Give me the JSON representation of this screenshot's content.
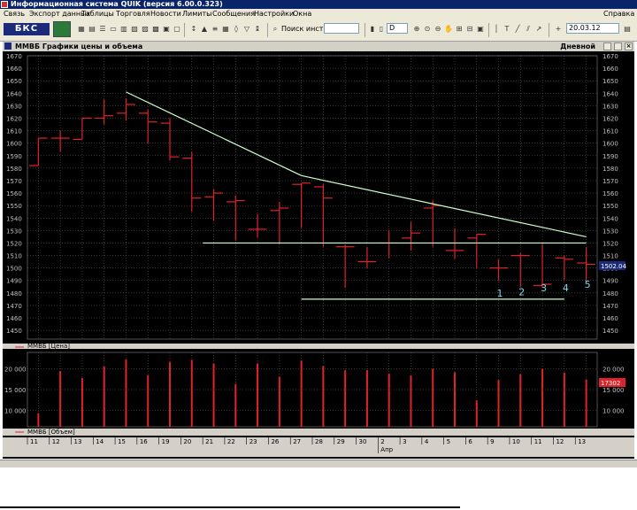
{
  "window": {
    "title": "Информационная система QUIK (версия 6.00.0.323)"
  },
  "menu": {
    "items": [
      "Связь",
      "Экспорт данных",
      "Таблицы",
      "Торговля",
      "Новости",
      "Лимиты",
      "Сообщения",
      "Настройки",
      "Окна"
    ],
    "help": "Справка"
  },
  "toolbar": {
    "logo": "БКС",
    "search_label": "Поиск инстр-та",
    "period_value": "D",
    "date_value": "20.03.12"
  },
  "panel": {
    "title": "ММВБ Графики цены и объема",
    "interval": "Дневной"
  },
  "legend": {
    "price": "ММВБ [Цена]",
    "volume": "ММВБ [Объем]"
  },
  "price_value_label": "1502.04",
  "volume_value_label": "17302",
  "chart_data": [
    {
      "type": "ohlc",
      "instrument": "ММВБ",
      "y_ticks": [
        1450,
        1460,
        1470,
        1480,
        1490,
        1500,
        1510,
        1520,
        1530,
        1540,
        1550,
        1560,
        1570,
        1580,
        1590,
        1600,
        1610,
        1620,
        1630,
        1640,
        1650,
        1660,
        1670
      ],
      "ylim": [
        1443,
        1670
      ],
      "x_labels": [
        "11",
        "12",
        "13",
        "14",
        "15",
        "16",
        "19",
        "20",
        "21",
        "22",
        "23",
        "26",
        "27",
        "28",
        "29",
        "30",
        "2",
        "3",
        "4",
        "5",
        "6",
        "9",
        "10",
        "11",
        "12",
        "13"
      ],
      "month_label": "Апр",
      "bars": [
        {
          "o": 1582,
          "h": 1601,
          "l": 1582,
          "c": 1604
        },
        {
          "o": 1604,
          "h": 1610,
          "l": 1593,
          "c": 1604
        },
        {
          "o": 1603,
          "h": 1617,
          "l": 1603,
          "c": 1620
        },
        {
          "o": 1620,
          "h": 1635,
          "l": 1615,
          "c": 1622
        },
        {
          "o": 1624,
          "h": 1636,
          "l": 1618,
          "c": 1631
        },
        {
          "o": 1624,
          "h": 1627,
          "l": 1600,
          "c": 1617
        },
        {
          "o": 1616,
          "h": 1620,
          "l": 1586,
          "c": 1589
        },
        {
          "o": 1588,
          "h": 1593,
          "l": 1545,
          "c": 1556
        },
        {
          "o": 1557,
          "h": 1563,
          "l": 1538,
          "c": 1560
        },
        {
          "o": 1553,
          "h": 1558,
          "l": 1522,
          "c": 1554
        },
        {
          "o": 1531,
          "h": 1543,
          "l": 1524,
          "c": 1531
        },
        {
          "o": 1546,
          "h": 1553,
          "l": 1519,
          "c": 1548
        },
        {
          "o": 1567,
          "h": 1566,
          "l": 1532,
          "c": 1568
        },
        {
          "o": 1565,
          "h": 1567,
          "l": 1517,
          "c": 1556
        },
        {
          "o": 1517,
          "h": 1519,
          "l": 1484,
          "c": 1517
        },
        {
          "o": 1505,
          "h": 1517,
          "l": 1500,
          "c": 1505
        },
        {
          "o": 1520,
          "h": 1530,
          "l": 1508,
          "c": 1520
        },
        {
          "o": 1524,
          "h": 1537,
          "l": 1514,
          "c": 1528
        },
        {
          "o": 1548,
          "h": 1554,
          "l": 1517,
          "c": 1550
        },
        {
          "o": 1514,
          "h": 1532,
          "l": 1507,
          "c": 1514
        },
        {
          "o": 1524,
          "h": 1527,
          "l": 1500,
          "c": 1527
        },
        {
          "o": 1500,
          "h": 1507,
          "l": 1490,
          "c": 1500
        },
        {
          "o": 1510,
          "h": 1512,
          "l": 1485,
          "c": 1510
        },
        {
          "o": 1486,
          "h": 1520,
          "l": 1484,
          "c": 1487
        },
        {
          "o": 1508,
          "h": 1510,
          "l": 1490,
          "c": 1507
        },
        {
          "o": 1504,
          "h": 1517,
          "l": 1490,
          "c": 1503
        }
      ],
      "lines": [
        {
          "from": [
            4,
            1641
          ],
          "to": [
            12,
            1574
          ]
        },
        {
          "from": [
            12,
            1574
          ],
          "to": [
            25,
            1525
          ]
        },
        {
          "from": [
            7.5,
            1520
          ],
          "to": [
            25,
            1520
          ]
        },
        {
          "from": [
            12,
            1475
          ],
          "to": [
            24,
            1475
          ]
        }
      ],
      "wave_labels": [
        "1",
        "2",
        "3",
        "4",
        "5"
      ],
      "wave_points": [
        {
          "x": 21,
          "y": 1480
        },
        {
          "x": 22,
          "y": 1481
        },
        {
          "x": 23,
          "y": 1484
        },
        {
          "x": 24,
          "y": 1484
        },
        {
          "x": 25,
          "y": 1487
        }
      ],
      "colors": {
        "price": "#e0222a",
        "trend": "#ccffcc",
        "wave": "#7fd4f0",
        "grid": "#6a6a6a"
      }
    },
    {
      "type": "bar",
      "series_name": "ММВБ [Объем]",
      "y_ticks": [
        10000,
        15000,
        20000
      ],
      "y_tick_labels": [
        "10 000",
        "15 000",
        "20 000"
      ],
      "ylim": [
        6000,
        24000
      ],
      "values": [
        9300,
        19500,
        17800,
        20600,
        22300,
        18500,
        21700,
        22200,
        21300,
        16400,
        21300,
        18100,
        22000,
        20700,
        19700,
        19700,
        18900,
        18400,
        20000,
        19200,
        12400,
        17300,
        18700,
        20000,
        19100,
        17400
      ]
    }
  ]
}
